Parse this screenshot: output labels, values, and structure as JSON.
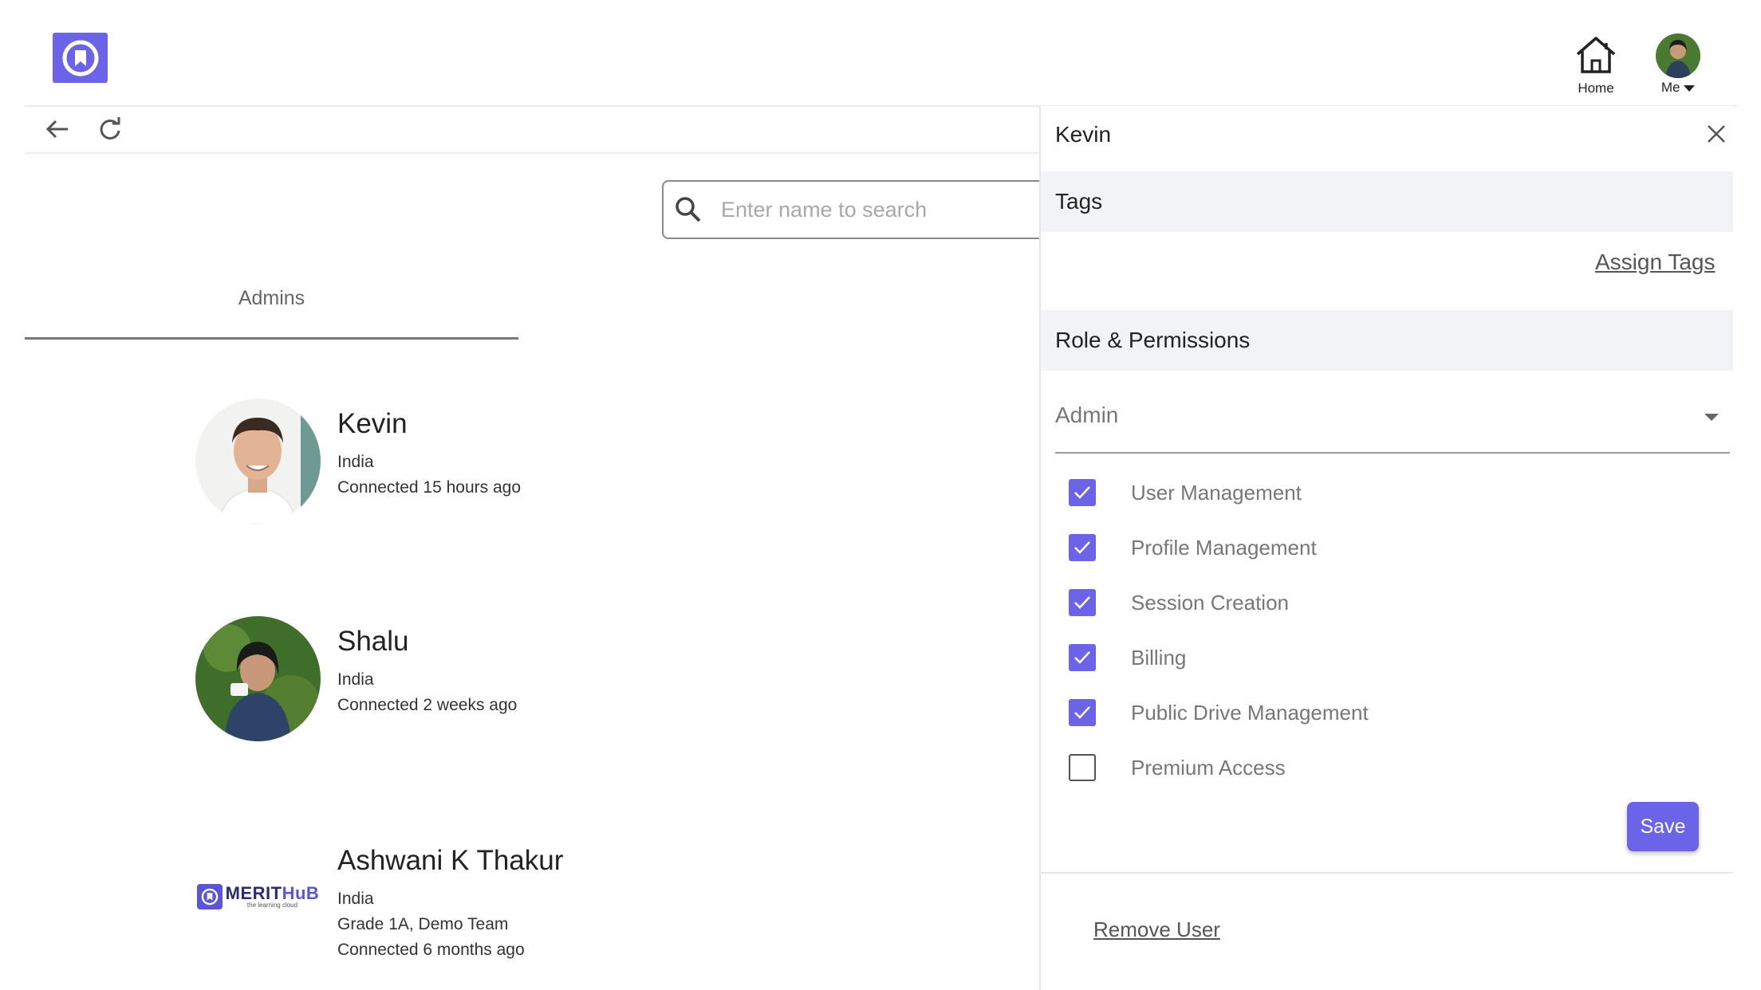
{
  "header": {
    "home_label": "Home",
    "me_label": "Me"
  },
  "search": {
    "placeholder": "Enter name to search"
  },
  "tabs": [
    {
      "label": "Admins",
      "active": true
    }
  ],
  "users": [
    {
      "name": "Kevin",
      "country": "India",
      "extra": "",
      "status": "Connected 15 hours ago"
    },
    {
      "name": "Shalu",
      "country": "India",
      "extra": "",
      "status": "Connected 2 weeks ago"
    },
    {
      "name": "Ashwani K Thakur",
      "country": "India",
      "extra": "Grade 1A, Demo Team",
      "status": "Connected 6 months ago",
      "logo": {
        "word_a": "MERIT",
        "word_b": "HuB",
        "tagline": "the learning cloud"
      }
    }
  ],
  "panel": {
    "title": "Kevin",
    "tags_heading": "Tags",
    "assign_tags_label": "Assign Tags",
    "role_heading": "Role & Permissions",
    "role_value": "Admin",
    "permissions": [
      {
        "label": "User Management",
        "checked": true
      },
      {
        "label": "Profile Management",
        "checked": true
      },
      {
        "label": "Session Creation",
        "checked": true
      },
      {
        "label": "Billing",
        "checked": true
      },
      {
        "label": "Public Drive Management",
        "checked": true
      },
      {
        "label": "Premium Access",
        "checked": false
      }
    ],
    "save_label": "Save",
    "remove_user_label": "Remove User"
  },
  "colors": {
    "accent": "#6b63e8",
    "section_bg": "#f1f3f6",
    "muted_text": "#777777"
  }
}
